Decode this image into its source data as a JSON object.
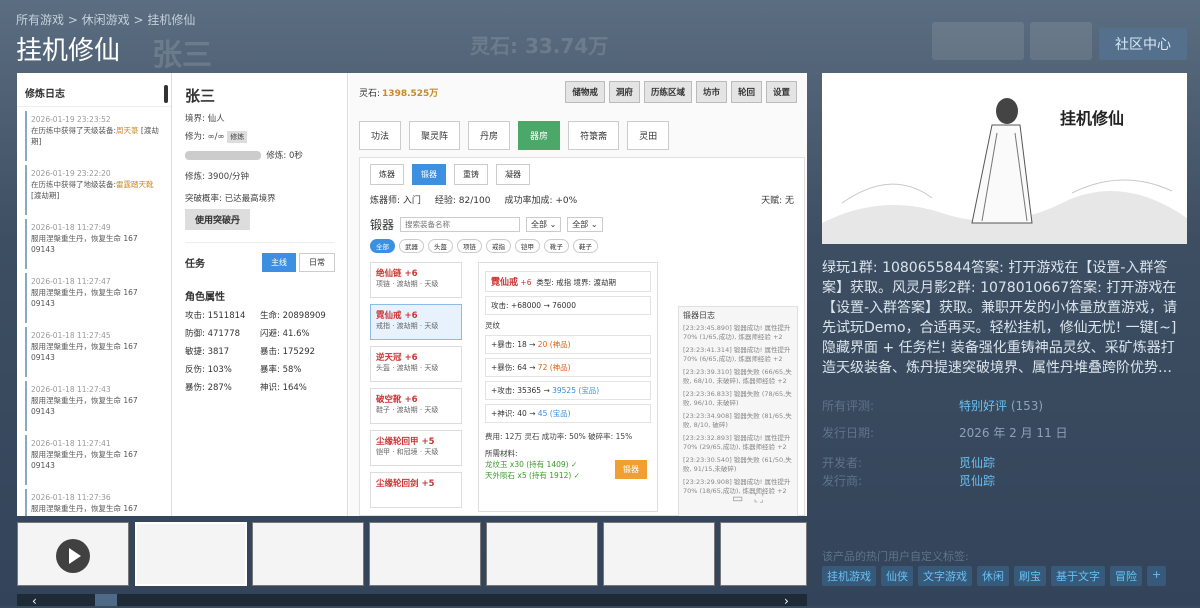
{
  "breadcrumb": "所有游戏 > 休闲游戏 > 挂机修仙",
  "game_title": "挂机修仙",
  "community_button": "社区中心",
  "ghost": {
    "name": "张三",
    "spirit_stone": "灵石: 33.74万",
    "btn1": "储物戒",
    "btn2": "洞府"
  },
  "screenshot": {
    "log_title": "修炼日志",
    "logs": [
      {
        "time": "2026-01-19 23:23:52",
        "text": "在历练中获得了天级装备:",
        "hl": "周天箓",
        "tail": "[渡劫期]"
      },
      {
        "time": "2026-01-19 23:22:20",
        "text": "在历练中获得了地级装备:",
        "hl": "雷霆踏天靴",
        "tail": "[渡劫期]"
      },
      {
        "time": "2026-01-18 11:27:49",
        "text": "服用涅槃重生丹，恢复生命 167",
        "hl": "",
        "tail": "09143"
      },
      {
        "time": "2026-01-18 11:27:47",
        "text": "服用涅槃重生丹，恢复生命 167",
        "hl": "",
        "tail": "09143"
      },
      {
        "time": "2026-01-18 11:27:45",
        "text": "服用涅槃重生丹，恢复生命 167",
        "hl": "",
        "tail": "09143"
      },
      {
        "time": "2026-01-18 11:27:43",
        "text": "服用涅槃重生丹，恢复生命 167",
        "hl": "",
        "tail": "09143"
      },
      {
        "time": "2026-01-18 11:27:41",
        "text": "服用涅槃重生丹，恢复生命 167",
        "hl": "",
        "tail": "09143"
      },
      {
        "time": "2026-01-18 11:27:36",
        "text": "服用涅槃重生丹，恢复生命 167",
        "hl": "",
        "tail": ""
      }
    ],
    "char_name": "张三",
    "realm": "境界: 仙人",
    "cultivation": "修为: ∞/∞",
    "cultivate_tag": "修炼",
    "cultivate_rate_label": "修炼: 0秒",
    "cultivate_speed": "修炼:      3900/分钟",
    "breakthrough": "突破概率:  已达最高境界",
    "breakthrough_btn": "使用突破丹",
    "task_title": "任务",
    "task_tab_main": "主线",
    "task_tab_daily": "日常",
    "attr_title": "角色属性",
    "attrs": [
      [
        "攻击: 1511814",
        "生命: 20898909"
      ],
      [
        "防御: 471778",
        "闪避: 41.6%"
      ],
      [
        "敏捷: 3817",
        "暴击: 175292"
      ],
      [
        "反伤: 103%",
        "暴率: 58%"
      ],
      [
        "暴伤: 287%",
        "神识: 164%"
      ]
    ],
    "spirit_label": "灵石:",
    "spirit_value": "1398.525万",
    "top_buttons": [
      "储物戒",
      "洞府",
      "历练区域",
      "坊市",
      "轮回",
      "设置"
    ],
    "tabs": [
      "功法",
      "聚灵阵",
      "丹房",
      "器房",
      "符箓斋",
      "灵田"
    ],
    "active_tab": "器房",
    "sub_tabs": [
      "炼器",
      "锻器",
      "重铸",
      "凝器"
    ],
    "forger_line": [
      "炼器师: 入门",
      "经验: 82/100",
      "成功率加成: +0%"
    ],
    "talent": "天赋: 无",
    "forge_title": "锻器",
    "search_placeholder": "搜索装备名称",
    "select_all1": "全部",
    "select_all2": "全部",
    "chips": [
      "全部",
      "武器",
      "头盔",
      "项链",
      "戒指",
      "铠甲",
      "靴子",
      "鞋子"
    ],
    "items": [
      {
        "name": "绝仙链 +6",
        "sub": "项链 · 渡劫期 · 天级"
      },
      {
        "name": "霓仙戒 +6",
        "sub": "戒指 · 渡劫期 · 天级"
      },
      {
        "name": "逆天冠 +6",
        "sub": "头盔 · 渡劫期 · 天级"
      },
      {
        "name": "破空靴 +6",
        "sub": "鞋子 · 渡劫期 · 天级"
      },
      {
        "name": "尘缘轮回甲 +5",
        "sub": "铠甲 · 和冠境 · 天级"
      },
      {
        "name": "尘缘轮回剑 +5",
        "sub": ""
      }
    ],
    "detail": {
      "name": "霓仙戒",
      "plus": "+6",
      "info": "类型: 戒指 境界: 渡劫期",
      "atk": "攻击: +68000 → 76000",
      "lingwen": "灵纹",
      "rows": [
        {
          "a": "+暴击: 18 →",
          "b": "20",
          "c": "(神品)"
        },
        {
          "a": "+暴伤: 64 →",
          "b": "72",
          "c": "(神品)"
        },
        {
          "a": "+攻击: 35365 →",
          "b": "39525",
          "c": "(宝品)"
        },
        {
          "a": "+神识: 40 →",
          "b": "45",
          "c": "(宝品)"
        }
      ],
      "cost": "费用: 12万 灵石 成功率: 50% 破碎率: 15%",
      "materials_label": "所需材料:",
      "mat1": "龙纹玉 x30 (持有 1409) ✓",
      "mat2": "天外陨石 x5 (持有 1912) ✓",
      "forge_button": "锻器"
    },
    "forge_log_title": "锻器日志",
    "forge_logs": [
      "[23:23:45.890] 锻器成功! 属性提升70% (1/65,成功), 炼器师经验 +2",
      "[23:23:41.314] 锻器成功! 属性提升70% (6/65,成功), 炼器师经验 +2",
      "[23:23:39.310] 锻器失败 (66/65,失败, 68/10, 未破碎), 炼器师经验 +2",
      "[23:23:36.833] 锻器失败 (78/65,失败, 96/10, 未破碎)",
      "[23:23:34.908] 锻器失败 (81/65,失败, 8/10, 破碎)",
      "[23:23:32.893] 锻器成功! 属性提升70% (29/65,成功), 炼器师经验 +2",
      "[23:23:30.540] 锻器失败 (61/50,失败, 91/15,未破碎)",
      "[23:23:29.908] 锻器成功! 属性提升70% (18/65,成功), 炼器师经验 +2"
    ]
  },
  "capsule_title": "挂机修仙",
  "description": "绿玩1群: 1080655844答案: 打开游戏在【设置-入群答案】获取。风灵月影2群: 1078010667答案: 打开游戏在【设置-入群答案】获取。兼职开发的小体量放置游戏，请先试玩Demo，合适再买。轻松挂机，修仙无忧! 一键[~]隐藏界面 + 任务栏! 装备强化重铸神品灵纹、采矿炼器打造天级装备、炼丹提速突破境界、属性丹堆叠跨阶优势…",
  "reviews_label": "所有评测:",
  "reviews_value": "特别好评",
  "reviews_count": "(153)",
  "release_label": "发行日期:",
  "release_value": "2026 年 2 月 11 日",
  "developer_label": "开发者:",
  "developer_value": "觅仙踪",
  "publisher_label": "发行商:",
  "publisher_value": "觅仙踪",
  "tags_label": "该产品的热门用户自定义标签:",
  "tags": [
    "挂机游戏",
    "仙侠",
    "文字游戏",
    "休闲",
    "刷宝",
    "基于文字",
    "冒险",
    "+"
  ],
  "colors": {
    "accent": "#67c1f5",
    "positive": "#66c0f4",
    "green_tab": "#4ca868",
    "blue_tab": "#3d8fe0",
    "gold": "#c8882a"
  }
}
